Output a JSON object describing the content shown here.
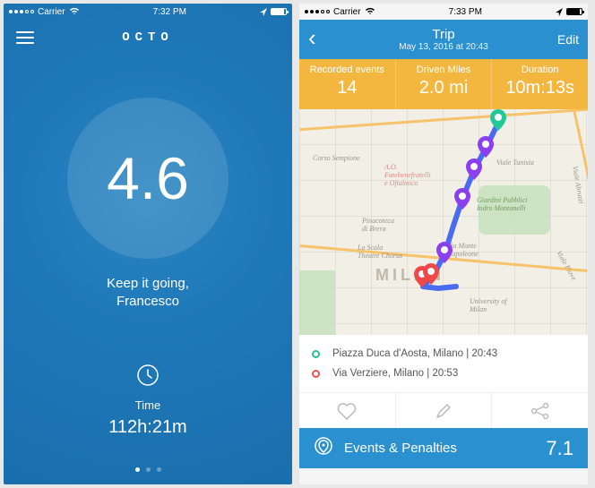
{
  "screen1": {
    "status": {
      "carrier": "Carrier",
      "time": "7:32 PM"
    },
    "logo": "OCTO",
    "score": "4.6",
    "subtitle_line1": "Keep it going,",
    "subtitle_line2": "Francesco",
    "time_label": "Time",
    "time_value": "112h:21m"
  },
  "screen2": {
    "status": {
      "carrier": "Carrier",
      "time": "7:33 PM"
    },
    "nav": {
      "title": "Trip",
      "subtitle": "May 13, 2016 at 20:43",
      "edit": "Edit"
    },
    "stats": [
      {
        "label": "Recorded events",
        "value": "14"
      },
      {
        "label": "Driven Miles",
        "value": "2.0 mi"
      },
      {
        "label": "Duration",
        "value": "10m:13s"
      }
    ],
    "map_labels": {
      "city": "MILAN",
      "p1": "Corso Sempione",
      "p2": "A.O.\nFatebenefratelli\ne Oftalmico",
      "p3": "Giardini Pubblici\nIndro Montanelli",
      "p4": "Pinacoteca\ndi Brera",
      "p5": "La Scala\nTheatre Chorus",
      "p6": "Via Monte\nNapoleone",
      "p7": "University of\nMilan",
      "p8": "Viale Tunisia",
      "p9": "Viale Abruzzi",
      "p10": "Viale Piave"
    },
    "legend": {
      "start": "Piazza Duca d'Aosta, Milano | 20:43",
      "end": "Via Verziere, Milano | 20:53"
    },
    "events": {
      "label": "Events & Penalties",
      "score": "7.1"
    }
  }
}
